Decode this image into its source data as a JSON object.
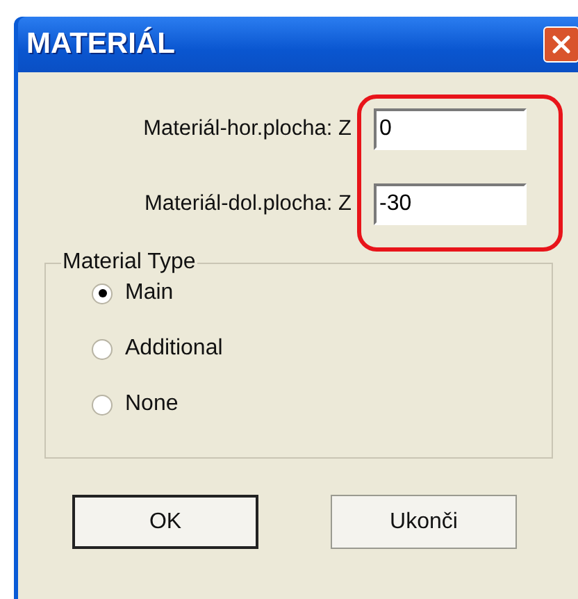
{
  "window": {
    "title": "MATERIÁL"
  },
  "fields": [
    {
      "label": "Materiál-hor.plocha: Z",
      "value": "0"
    },
    {
      "label": "Materiál-dol.plocha: Z",
      "value": "-30"
    }
  ],
  "material_type": {
    "title": "Material Type",
    "options": [
      {
        "label": "Main",
        "selected": true
      },
      {
        "label": "Additional",
        "selected": false
      },
      {
        "label": "None",
        "selected": false
      }
    ]
  },
  "buttons": [
    {
      "label": "OK",
      "default": true
    },
    {
      "label": "Ukonči",
      "default": false
    }
  ]
}
